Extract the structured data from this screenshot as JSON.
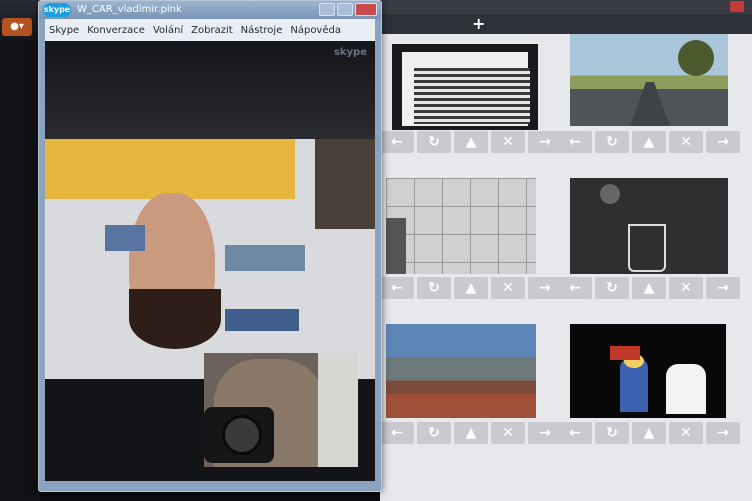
{
  "background": {
    "new_tab_symbol": "+",
    "left_button_label": "●▾"
  },
  "skype": {
    "logo_text": "skype",
    "title": "W_CAR_vladimir.pink",
    "watermark": "skype",
    "menu": [
      "Skype",
      "Konverzace",
      "Volání",
      "Zobrazit",
      "Nástroje",
      "Nápověda"
    ]
  },
  "gallery": {
    "controls": [
      {
        "name": "left-arrow-icon",
        "glyph": "←"
      },
      {
        "name": "rotate-icon",
        "glyph": "↻"
      },
      {
        "name": "up-arrow-icon",
        "glyph": "▲"
      },
      {
        "name": "close-icon",
        "glyph": "✕"
      },
      {
        "name": "right-arrow-icon",
        "glyph": "→"
      }
    ]
  }
}
